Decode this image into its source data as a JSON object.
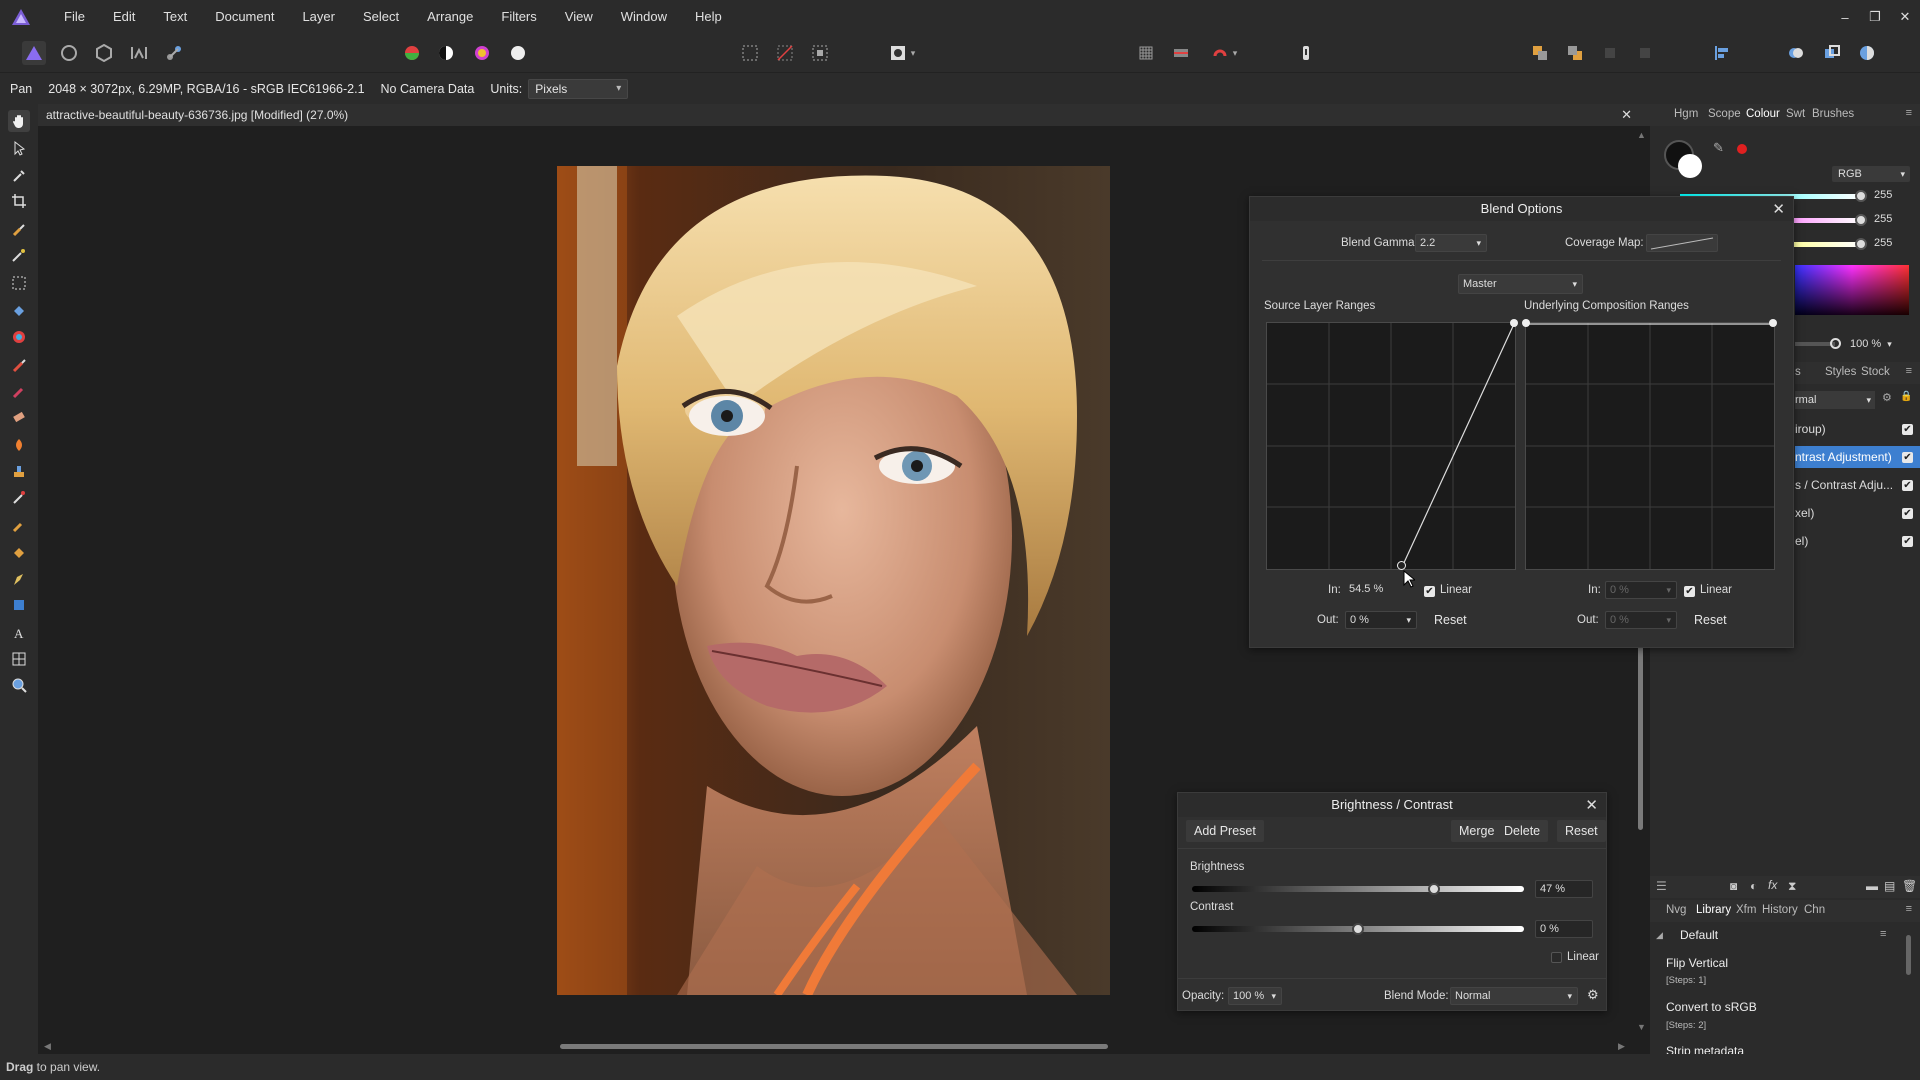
{
  "menubar": {
    "items": [
      "File",
      "Edit",
      "Text",
      "Document",
      "Layer",
      "Select",
      "Arrange",
      "Filters",
      "View",
      "Window",
      "Help"
    ],
    "window_controls": [
      "–",
      "❐",
      "✕"
    ]
  },
  "contextbar": {
    "tool": "Pan",
    "doc_info": "2048 × 3072px, 6.29MP, RGBA/16 - sRGB IEC61966-2.1",
    "camera": "No Camera Data",
    "units_label": "Units:",
    "units_value": "Pixels"
  },
  "document": {
    "tab_title": "attractive-beautiful-beauty-636736.jpg [Modified] (27.0%)"
  },
  "status": {
    "bold": "Drag",
    "text": " to pan view."
  },
  "right_panel": {
    "top_tabs": [
      "Hgm",
      "Scope",
      "Colour",
      "Swt",
      "Brushes"
    ],
    "active_top_tab": "Colour",
    "colour_model": "RGB",
    "channel_values": [
      "255",
      "255",
      "255"
    ],
    "opacity": "100 %",
    "mid_tabs": [
      "s",
      "Styles",
      "Stock"
    ],
    "layer_blend": "rmal",
    "layers": [
      "iroup)",
      "ntrast Adjustment)",
      "s / Contrast Adju...",
      "xel)",
      "el)"
    ],
    "bottom_tabs": [
      "Nvg",
      "Library",
      "Xfm",
      "History",
      "Chn"
    ],
    "active_bottom_tab": "Library",
    "library_group": "Default",
    "history": [
      {
        "name": "Flip Vertical",
        "steps": "[Steps: 1]"
      },
      {
        "name": "Convert to sRGB",
        "steps": "[Steps: 2]"
      },
      {
        "name": "Strip metadata",
        "steps": ""
      }
    ]
  },
  "blend_options": {
    "title": "Blend Options",
    "gamma_label": "Blend Gamma:",
    "gamma_value": "2.2",
    "coverage_label": "Coverage Map:",
    "channel": "Master",
    "source_label": "Source Layer Ranges",
    "underlying_label": "Underlying Composition Ranges",
    "source": {
      "in_label": "In:",
      "in_value": "54.5 %",
      "out_label": "Out:",
      "out_value": "0 %",
      "linear_label": "Linear",
      "reset": "Reset"
    },
    "underlying": {
      "in_label": "In:",
      "in_value": "0 %",
      "out_label": "Out:",
      "out_value": "0 %",
      "linear_label": "Linear",
      "reset": "Reset"
    }
  },
  "brightness_contrast": {
    "title": "Brightness / Contrast",
    "add_preset": "Add Preset",
    "merge": "Merge",
    "delete": "Delete",
    "reset": "Reset",
    "brightness_label": "Brightness",
    "brightness_value": "47 %",
    "brightness_level": 0.73,
    "contrast_label": "Contrast",
    "contrast_value": "0 %",
    "contrast_level": 0.5,
    "linear_label": "Linear",
    "opacity_label": "Opacity:",
    "opacity_value": "100 %",
    "blend_mode_label": "Blend Mode:",
    "blend_mode_value": "Normal"
  },
  "colors": {
    "accent": "#3d7fd0",
    "panel": "#2b2b2b",
    "canvas": "#1f1f1f"
  }
}
